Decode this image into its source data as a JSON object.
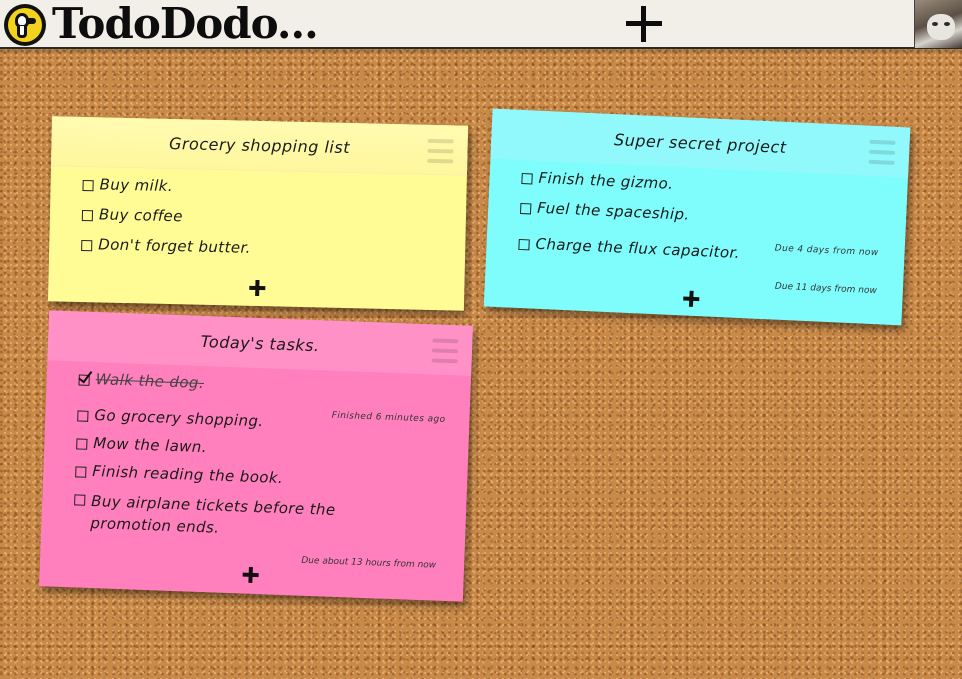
{
  "app": {
    "title": "TodoDodo...",
    "logo_icon": "dodo-logo-icon",
    "add_note_icon": "plus-icon",
    "avatar_icon": "cat-avatar-icon"
  },
  "notes": [
    {
      "title": "Grocery shopping list",
      "color": "#fffc96",
      "items": [
        {
          "text": "Buy milk.",
          "done": false,
          "meta": ""
        },
        {
          "text": "Buy coffee",
          "done": false,
          "meta": ""
        },
        {
          "text": "Don't forget butter.",
          "done": false,
          "meta": ""
        }
      ]
    },
    {
      "title": "Super secret project",
      "color": "#7ffcfc",
      "items": [
        {
          "text": "Finish the gizmo.",
          "done": false,
          "meta": ""
        },
        {
          "text": "Fuel the spaceship.",
          "done": false,
          "meta": ""
        },
        {
          "text": "Charge the flux capacitor.",
          "done": false,
          "meta": "Due 4 days from now"
        }
      ],
      "footer_meta": "Due 11 days from now"
    },
    {
      "title": "Today's tasks.",
      "color": "#ff80bc",
      "items": [
        {
          "text": "Walk the dog.",
          "done": true,
          "meta": ""
        },
        {
          "text": "Go grocery shopping.",
          "done": false,
          "meta": "Finished 6 minutes ago"
        },
        {
          "text": "Mow the lawn.",
          "done": false,
          "meta": ""
        },
        {
          "text": "Finish reading the book.",
          "done": false,
          "meta": ""
        },
        {
          "text": "Buy airplane tickets before the promotion ends.",
          "done": false,
          "meta": ""
        }
      ],
      "footer_meta": "Due about 13 hours from now"
    }
  ]
}
